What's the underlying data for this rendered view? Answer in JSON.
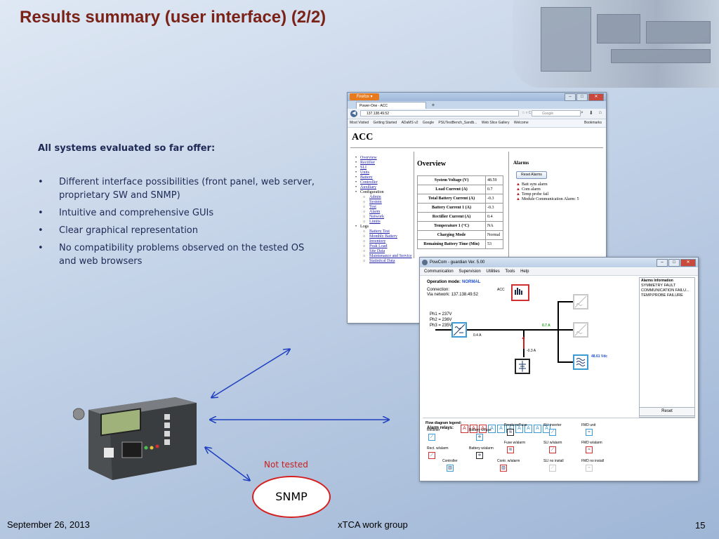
{
  "slide": {
    "title": "Results summary (user interface) (2/2)",
    "offer_heading": "All systems evaluated so far offer:",
    "bullets": [
      "Different interface possibilities (front panel, web server, proprietary SW and SNMP)",
      "Intuitive and comprehensive GUIs",
      "Clear graphical representation",
      "No compatibility problems observed on the tested OS and web browsers"
    ],
    "not_tested": "Not tested",
    "snmp": "SNMP",
    "footer": {
      "date": "September 26, 2013",
      "group": "xTCA work group",
      "page": "15"
    }
  },
  "browser": {
    "firefox_button": "Firefox ▾",
    "tab_title": "Power-One - ACC",
    "new_tab": "+",
    "url": "137.138.49.52",
    "nav_mid": "☆ ▿ C",
    "search_placeholder": "Google",
    "bookmarks": [
      "Most Visited",
      "Getting Started",
      "ADaMS v2",
      "Google",
      "PSUTestBench_Sandb...",
      "Web Slice Gallery",
      "Welcome"
    ],
    "bookmarks_label": "Bookmarks",
    "page_title": "ACC",
    "nav": [
      {
        "label": "Overview",
        "link": true,
        "level": 0
      },
      {
        "label": "Rectifier",
        "link": true,
        "level": 0
      },
      {
        "label": "SLI",
        "link": true,
        "level": 0
      },
      {
        "label": "Units",
        "link": true,
        "level": 0
      },
      {
        "label": "Battery",
        "link": true,
        "level": 0
      },
      {
        "label": "Controller",
        "link": true,
        "level": 0
      },
      {
        "label": "Auxiliary",
        "link": true,
        "level": 0
      },
      {
        "label": "Configuration",
        "link": false,
        "level": 0
      },
      {
        "label": "Admin",
        "link": true,
        "level": 1
      },
      {
        "label": "System",
        "link": true,
        "level": 1
      },
      {
        "label": "Test",
        "link": true,
        "level": 1
      },
      {
        "label": "Alarm",
        "link": true,
        "level": 1
      },
      {
        "label": "Network",
        "link": true,
        "level": 1
      },
      {
        "label": "Limits",
        "link": true,
        "level": 1
      },
      {
        "label": "Logs",
        "link": false,
        "level": 0
      },
      {
        "label": "Battery Test",
        "link": true,
        "level": 1
      },
      {
        "label": "Monthly Battery",
        "link": true,
        "level": 1
      },
      {
        "label": "Inventory",
        "link": true,
        "level": 1
      },
      {
        "label": "Peak Load",
        "link": true,
        "level": 1
      },
      {
        "label": "Site Data",
        "link": true,
        "level": 1
      },
      {
        "label": "Maintenance and Service",
        "link": true,
        "level": 1
      },
      {
        "label": "Statistical Data",
        "link": true,
        "level": 1
      }
    ],
    "overview_title": "Overview",
    "overview_rows": [
      {
        "label": "System Voltage (V)",
        "value": "48.59"
      },
      {
        "label": "Load Current (A)",
        "value": "0.7"
      },
      {
        "label": "Total Battery Current (A)",
        "value": "-0.3"
      },
      {
        "label": "Battery Current 1 (A)",
        "value": "-0.3"
      },
      {
        "label": "Rectifier Current (A)",
        "value": "0.4"
      },
      {
        "label": "Temperature 1 (°C)",
        "value": "NA"
      },
      {
        "label": "Charging Mode",
        "value": "Normal"
      },
      {
        "label": "Remaining Battery Time (Min)",
        "value": "53"
      }
    ],
    "alarms_title": "Alarms",
    "reset_alarms": "Reset Alarms",
    "alarms": [
      "Batt sym alarm",
      "Com alarm",
      "Temp probe fail",
      "Module Communication Alarm: 5"
    ]
  },
  "app": {
    "title": "PowCom - guardian   Ver. 5.00",
    "menu": [
      "Communication",
      "Supervision",
      "Utilities",
      "Tools",
      "Help"
    ],
    "opmode_label": "Operation mode:",
    "opmode_value": "NORMAL",
    "connection": "Connection:",
    "via_network": "Via network: 137.138.49.52",
    "acc": "ACC",
    "phases": [
      "Ph1 = 237V",
      "Ph2 = 236V",
      "Ph3 = 235V"
    ],
    "rect_current": "0.4 A",
    "load_current": "0.7 A",
    "batt_current": "-0.3 A",
    "voltage": "48.61 Vdc",
    "alarm_relays_label": "Alarm relays:",
    "relays": [
      "A",
      "A",
      "A",
      "A",
      "A",
      "A",
      "A",
      "A",
      "A",
      "A"
    ],
    "alarms_info_title": "Alarms Information",
    "alarms_info": [
      "SYMMETRY FAULT",
      "COMMUNICATION FAILU...",
      "TEMP.PROBE FAILURE"
    ],
    "reset": "Reset",
    "legend_title": "Flow diagram legend:",
    "legend": [
      "Rectifier",
      "Battery w/fuse",
      "Breakers/Fuse",
      "SLI inverter",
      "FMD unit",
      "Rect. w/alarm",
      "Battery w/alarm",
      "Fuse w/alarm",
      "SLI w/alarm",
      "FMD w/alarm",
      "Controller",
      "Contr. w/alarm",
      "SLI no install",
      "FMD no install"
    ]
  },
  "colors": {
    "title": "#7b2218",
    "accent_blue": "#3c9bd5",
    "alarm_red": "#d23030",
    "arrow_blue": "#1f3fbf"
  }
}
